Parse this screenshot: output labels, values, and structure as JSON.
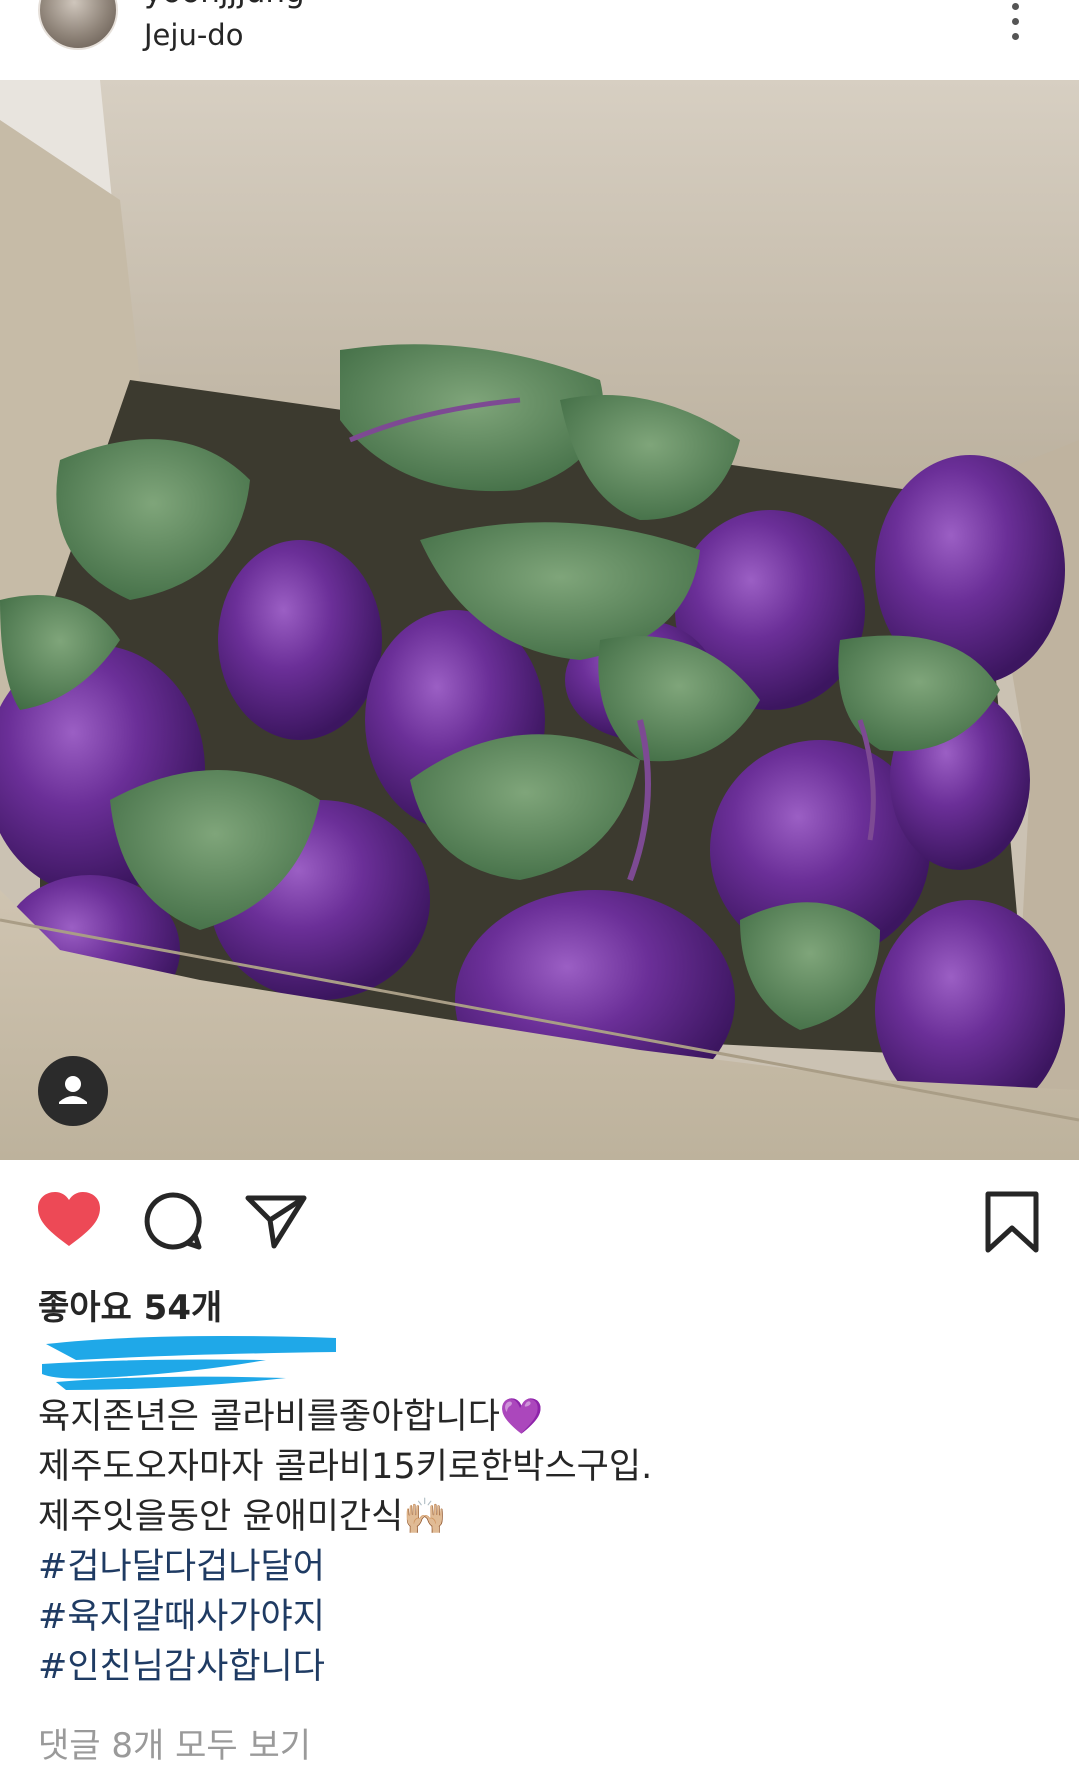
{
  "post": {
    "username": "yoonjjjung",
    "location": "Jeju-do",
    "likes_label": "좋아요 54개",
    "caption_lines": [
      "육지존년은 콜라비를좋아합니다💜",
      "제주도오자마자 콜라비15키로한박스구입.",
      "제주잇을동안 윤애미간식🙌🏼"
    ],
    "hashtags": [
      "#겁나달다겁나달어",
      "#육지갈때사가야지",
      "#인친님감사합니다"
    ],
    "comments_link": "댓글 8개 모두 보기"
  },
  "icons": {
    "like": "heart-icon-filled",
    "comment": "comment-bubble-icon",
    "share": "paper-plane-icon",
    "save": "bookmark-icon",
    "more": "more-vertical-icon",
    "tag": "person-tag-icon"
  },
  "colors": {
    "like_red": "#ed4956",
    "hashtag_blue": "#1f3b63",
    "scribble_blue": "#1fa8e8",
    "muted_gray": "#9a9a9a"
  }
}
